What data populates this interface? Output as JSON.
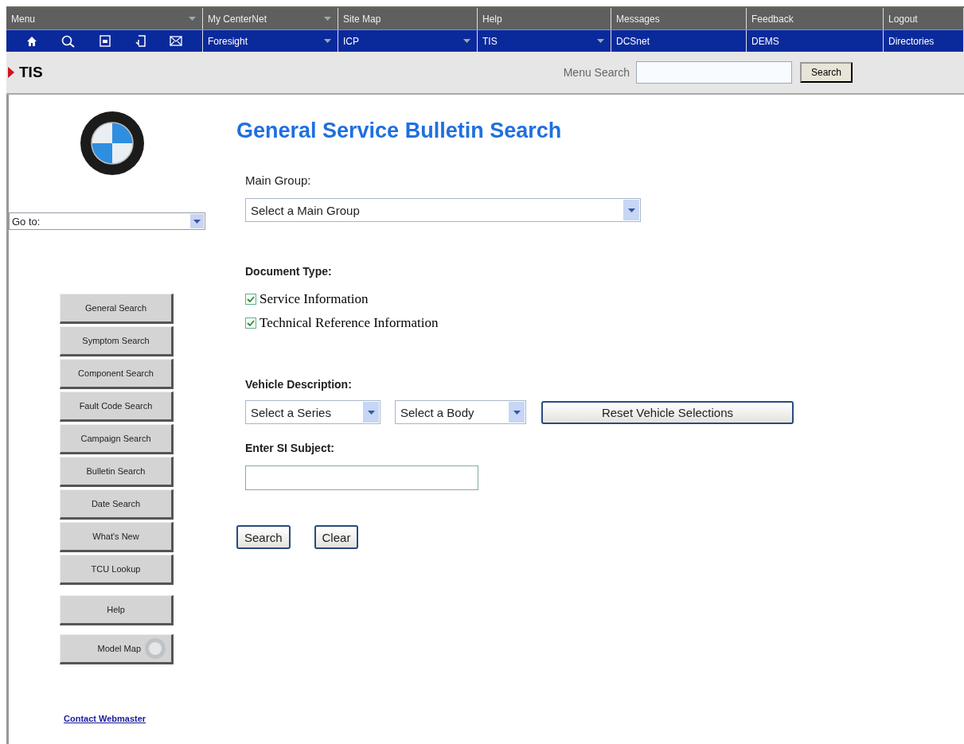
{
  "nav": {
    "top": [
      {
        "label": "Menu",
        "dropdown": true
      },
      {
        "label": "My CenterNet",
        "dropdown": true
      },
      {
        "label": "Site Map",
        "dropdown": false
      },
      {
        "label": "Help",
        "dropdown": false
      },
      {
        "label": "Messages",
        "dropdown": false
      },
      {
        "label": "Feedback",
        "dropdown": false
      },
      {
        "label": "Logout",
        "dropdown": false
      }
    ],
    "bottom": [
      {
        "label": "Foresight",
        "dropdown": true
      },
      {
        "label": "ICP",
        "dropdown": true
      },
      {
        "label": "TIS",
        "dropdown": true
      },
      {
        "label": "DCSnet",
        "dropdown": false
      },
      {
        "label": "DEMS",
        "dropdown": false
      },
      {
        "label": "Directories",
        "dropdown": false
      }
    ]
  },
  "header": {
    "title": "TIS",
    "search_label": "Menu Search",
    "search_button": "Search"
  },
  "sidebar": {
    "goto": "Go to:",
    "buttons": [
      {
        "label": "General Search",
        "kind": "nav"
      },
      {
        "label": "Symptom Search",
        "kind": "nav"
      },
      {
        "label": "Component Search",
        "kind": "nav"
      },
      {
        "label": "Fault Code Search",
        "kind": "nav"
      },
      {
        "label": "Campaign Search",
        "kind": "nav"
      },
      {
        "label": "Bulletin Search",
        "kind": "nav"
      },
      {
        "label": "Date Search",
        "kind": "nav"
      },
      {
        "label": "What's New",
        "kind": "nav"
      },
      {
        "label": "TCU Lookup",
        "kind": "nav"
      },
      {
        "label": "Help",
        "kind": "help"
      },
      {
        "label": "Model Map",
        "kind": "map"
      }
    ],
    "link": "Contact Webmaster"
  },
  "main": {
    "title": "General Service Bulletin Search",
    "main_group": {
      "label": "Main Group:",
      "value": "Select a Main Group"
    },
    "document_type": {
      "label": "Document Type:",
      "options": [
        {
          "label": "Service Information",
          "checked": true
        },
        {
          "label": "Technical Reference Information",
          "checked": true
        }
      ]
    },
    "vehicle": {
      "label": "Vehicle Description:",
      "series": "Select a Series",
      "body": "Select a Body",
      "reset": "Reset Vehicle Selections"
    },
    "subject": {
      "label": "Enter SI Subject:"
    },
    "buttons": [
      "Search",
      "Clear"
    ]
  }
}
